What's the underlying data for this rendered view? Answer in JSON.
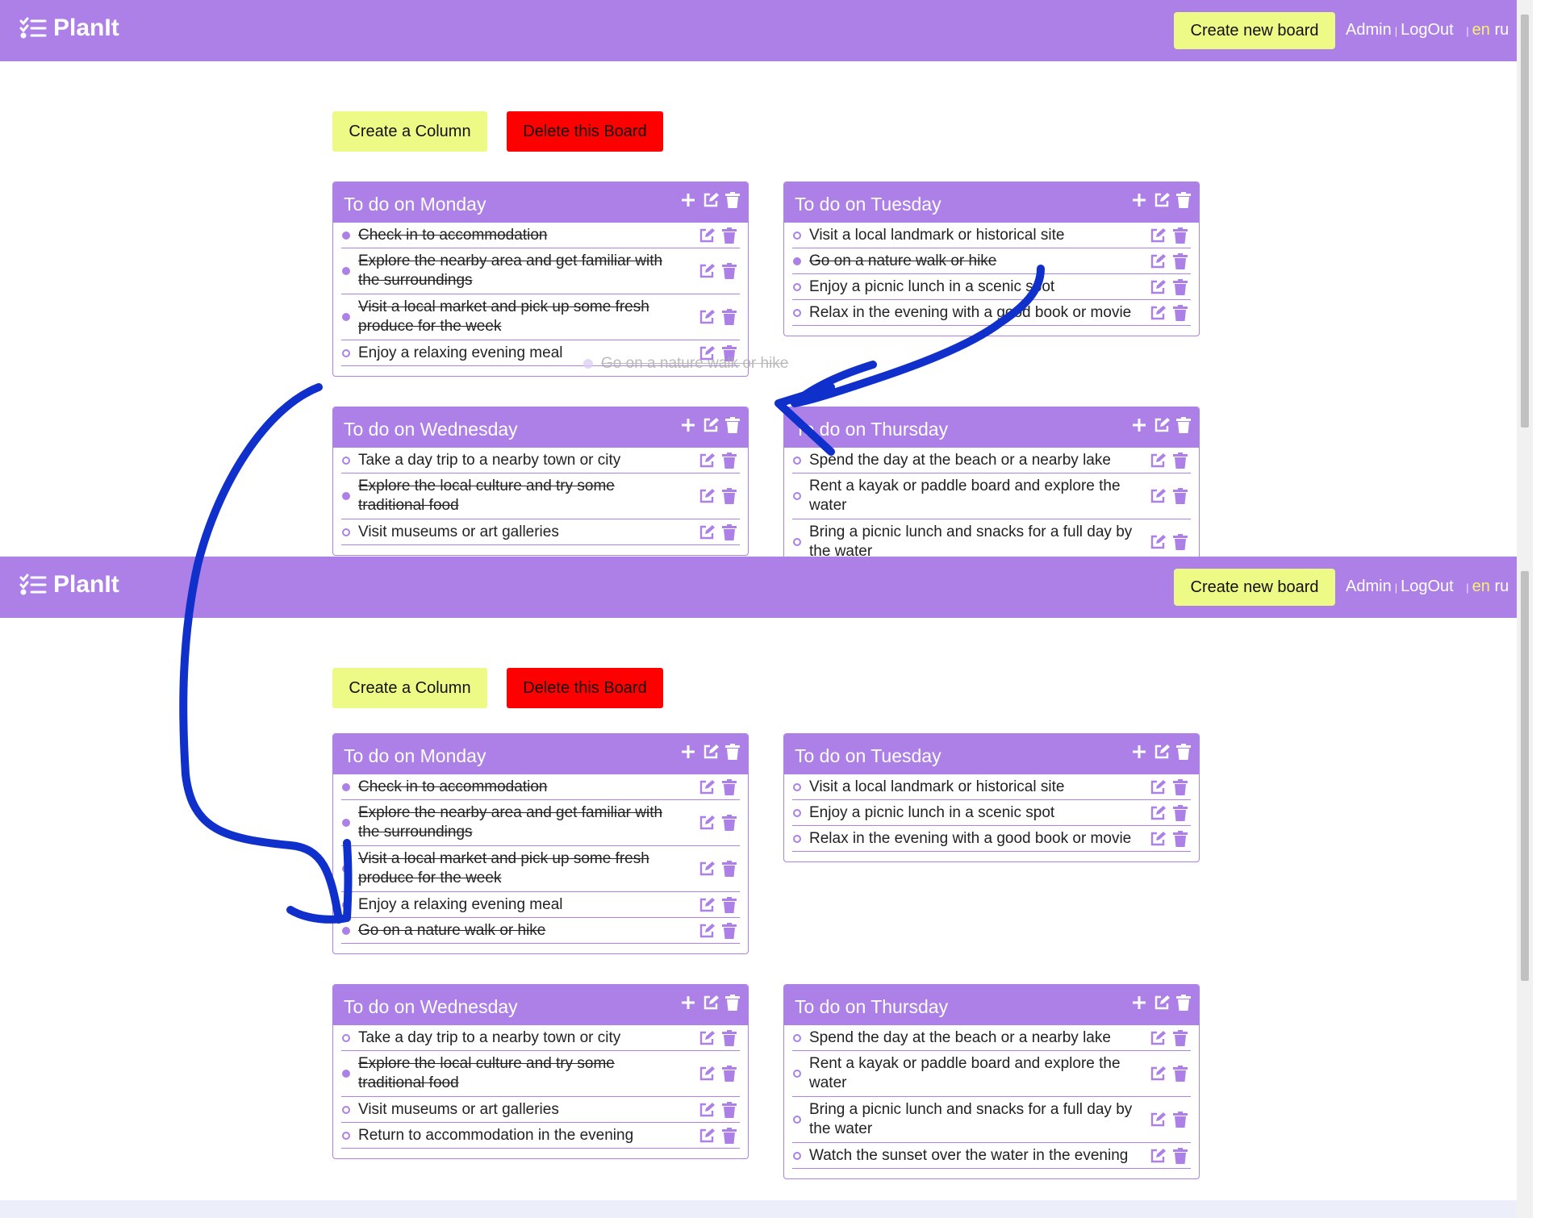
{
  "app": {
    "logo": "PlanIt"
  },
  "nav": {
    "create_board": "Create new board",
    "admin": "Admin",
    "logout": "LogOut",
    "lang_en": "en",
    "lang_ru": "ru",
    "separator": "|"
  },
  "board": {
    "create_column": "Create a Column",
    "delete_board": "Delete this Board"
  },
  "colors": {
    "accent": "#ad80e8",
    "highlight_button": "#eefa86",
    "danger": "#fe0000",
    "arrow": "#1030cc"
  },
  "icons": {
    "add": "plus-icon",
    "edit": "edit-icon",
    "delete": "trash-icon",
    "logo": "list-check-icon"
  },
  "before": {
    "columns": [
      {
        "title": "To do on Monday",
        "tasks": [
          {
            "text": "Check in to accommodation",
            "done": true
          },
          {
            "text": "Explore the nearby area and get familiar with the surroundings",
            "done": true
          },
          {
            "text": "Visit a local market and pick up some fresh produce for the week",
            "done": true
          },
          {
            "text": "Enjoy a relaxing evening meal",
            "done": false
          }
        ]
      },
      {
        "title": "To do on Tuesday",
        "tasks": [
          {
            "text": "Visit a local landmark or historical site",
            "done": false
          },
          {
            "text": "Go on a nature walk or hike",
            "done": true
          },
          {
            "text": "Enjoy a picnic lunch in a scenic spot",
            "done": false
          },
          {
            "text": "Relax in the evening with a good book or movie",
            "done": false
          }
        ]
      },
      {
        "title": "To do on Wednesday",
        "tasks": [
          {
            "text": "Take a day trip to a nearby town or city",
            "done": false
          },
          {
            "text": "Explore the local culture and try some traditional food",
            "done": true
          },
          {
            "text": "Visit museums or art galleries",
            "done": false
          }
        ]
      },
      {
        "title": "To do on Thursday",
        "tasks": [
          {
            "text": "Spend the day at the beach or a nearby lake",
            "done": false
          },
          {
            "text": "Rent a kayak or paddle board and explore the water",
            "done": false
          },
          {
            "text": "Bring a picnic lunch and snacks for a full day by the water",
            "done": false
          }
        ]
      }
    ],
    "drag_ghost": "Go on a nature walk or hike"
  },
  "after": {
    "columns": [
      {
        "title": "To do on Monday",
        "tasks": [
          {
            "text": "Check in to accommodation",
            "done": true
          },
          {
            "text": "Explore the nearby area and get familiar with the surroundings",
            "done": true
          },
          {
            "text": "Visit a local market and pick up some fresh produce for the week",
            "done": true
          },
          {
            "text": "Enjoy a relaxing evening meal",
            "done": false
          },
          {
            "text": "Go on a nature walk or hike",
            "done": true
          }
        ]
      },
      {
        "title": "To do on Tuesday",
        "tasks": [
          {
            "text": "Visit a local landmark or historical site",
            "done": false
          },
          {
            "text": "Enjoy a picnic lunch in a scenic spot",
            "done": false
          },
          {
            "text": "Relax in the evening with a good book or movie",
            "done": false
          }
        ]
      },
      {
        "title": "To do on Wednesday",
        "tasks": [
          {
            "text": "Take a day trip to a nearby town or city",
            "done": false
          },
          {
            "text": "Explore the local culture and try some traditional food",
            "done": true
          },
          {
            "text": "Visit museums or art galleries",
            "done": false
          },
          {
            "text": "Return to accommodation in the evening",
            "done": false
          }
        ]
      },
      {
        "title": "To do on Thursday",
        "tasks": [
          {
            "text": "Spend the day at the beach or a nearby lake",
            "done": false
          },
          {
            "text": "Rent a kayak or paddle board and explore the water",
            "done": false
          },
          {
            "text": "Bring a picnic lunch and snacks for a full day by the water",
            "done": false
          },
          {
            "text": "Watch the sunset over the water in the evening",
            "done": false
          }
        ]
      }
    ]
  }
}
